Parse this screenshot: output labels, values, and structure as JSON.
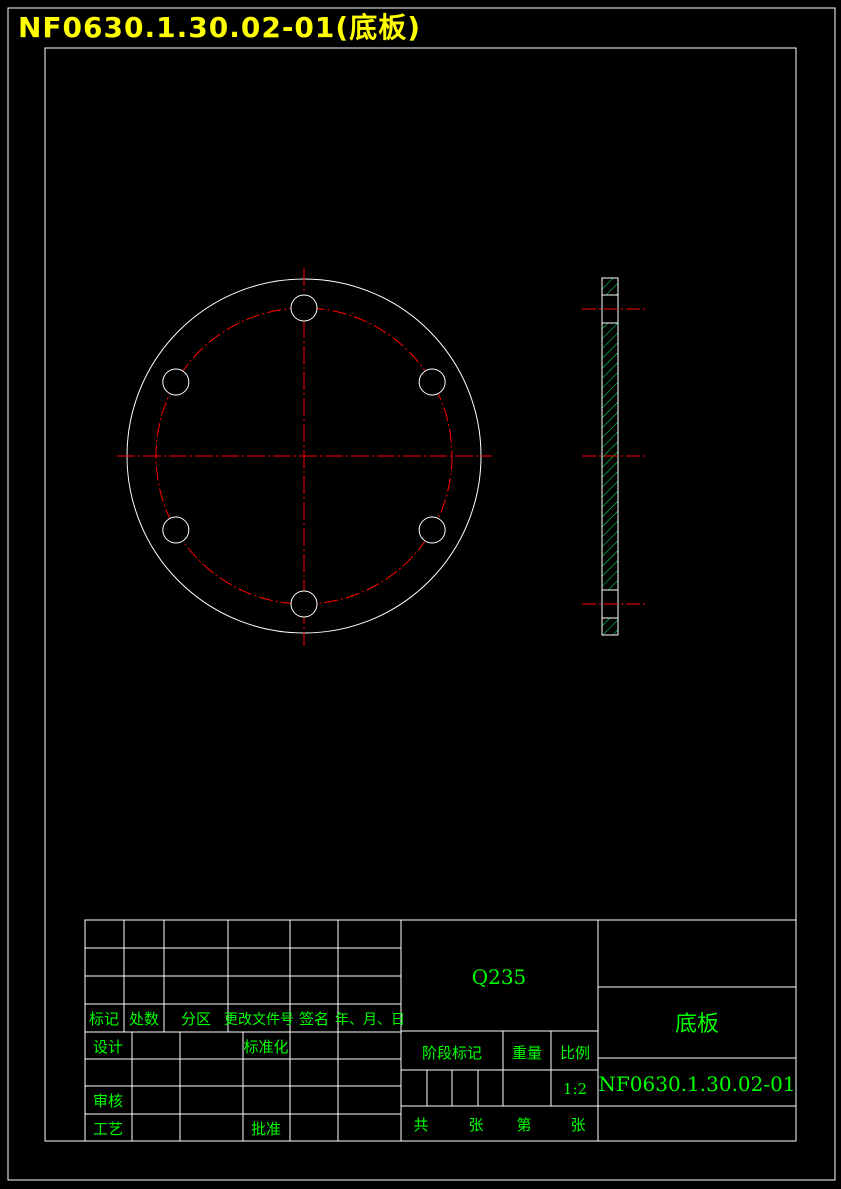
{
  "drawing_title": "NF0630.1.30.02-01(底板)",
  "colors": {
    "background": "#000000",
    "outline": "#ffffff",
    "centerline": "#ff0000",
    "hatch": "#00ff66",
    "table_text": "#00ff00",
    "title_text": "#ffff00"
  },
  "part": {
    "bolt_hole_count": 6
  },
  "title_block": {
    "material": "Q235",
    "part_name": "底板",
    "drawing_number": "NF0630.1.30.02-01",
    "scale": "1:2",
    "revision_headers": [
      "标记",
      "处数",
      "分区",
      "更改文件号",
      "签名",
      "年、月、日"
    ],
    "row_labels": {
      "design": "设计",
      "standardization": "标准化",
      "review": "审核",
      "process": "工艺",
      "approval": "批准"
    },
    "stage_mark": "阶段标记",
    "weight": "重量",
    "ratio": "比例",
    "total": "共",
    "sheets": "张",
    "sheet_no": "第",
    "sheet": "张"
  }
}
